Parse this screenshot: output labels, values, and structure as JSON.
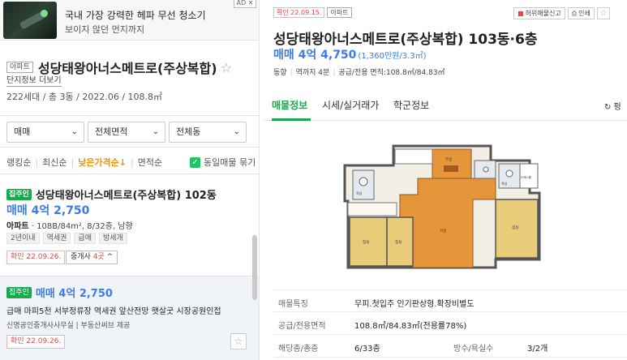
{
  "ad": {
    "title": "국내 가장 강력한 헤파 무선 청소기",
    "subtitle": "보이지 않던 먼지까지",
    "badge": "AD ✕"
  },
  "complex": {
    "type_tag": "아파트",
    "name": "성당태왕아너스메트로(주상복합)",
    "more_link": "단지정보 더보기",
    "info": "222세대 / 총 3동 / 2022.06 / 108.8㎡"
  },
  "filters": [
    {
      "label": "매매"
    },
    {
      "label": "전체면적"
    },
    {
      "label": "전체동"
    }
  ],
  "sort": {
    "options": [
      "랭킹순",
      "최신순",
      "낮은가격순↓",
      "면적순"
    ],
    "active_index": 2,
    "same_listing_label": "동일매물 묶기"
  },
  "listing1": {
    "badge": "집주인",
    "title": "성당태왕아너스메트로(주상복합) 102동",
    "price": "매매 4억 2,750",
    "detail_type": "아파트",
    "detail": " · 108B/84m², 8/32층, 남향",
    "chips": [
      "2년이내",
      "역세권",
      "급매",
      "방세개"
    ],
    "verify": "확인 22.09.26.",
    "agents_prefix": "중개사 ",
    "agents_count": "4곳",
    "agents_suffix": " ^"
  },
  "listing2": {
    "badge": "집주인",
    "price": "매매 4억 2,750",
    "desc": "급매 마피5천 서부정류장 역세권 앞산전망 햇살굿 시장공원인접",
    "agent": "신명공인중개사사무실 | 부동산써브 제공",
    "verify": "확인 22.09.26."
  },
  "detail": {
    "verify": "확인 22.09.15.",
    "type": "아파트",
    "report_label": "허위매물신고",
    "print_label": "인쇄",
    "title": "성당태왕아너스메트로(주상복합) 103동·6층",
    "price": "매매 4억 4,750",
    "price_per": "(1,360만원/3.3㎡)",
    "meta": [
      "동향",
      "역까지 4분",
      "공급/전용 면적:108.8㎡/84.83㎡"
    ],
    "tabs": [
      "매물정보",
      "시세/실거래가",
      "학군정보"
    ],
    "active_tab": 0,
    "refresh_label": "↻ 펑"
  },
  "floorplan": {
    "room_labels": [
      "침실",
      "침실",
      "거실",
      "침실",
      "주방",
      "드레스룸",
      "욕실",
      "욕실"
    ]
  },
  "info_table": [
    {
      "label": "매물특징",
      "value": "무피.첫입주 인기판상형.확장비별도"
    },
    {
      "label": "공급/전용면적",
      "value": "108.8㎡/84.83㎡(전용률78%)"
    },
    {
      "label": "해당층/총층",
      "value": "6/33층",
      "label2": "방수/욕실수",
      "value2": "3/2개"
    }
  ],
  "colors": {
    "accent_green": "#19a84d",
    "price_blue": "#3c7be8",
    "sort_orange": "#e8960e",
    "verify_red": "#e84545"
  }
}
